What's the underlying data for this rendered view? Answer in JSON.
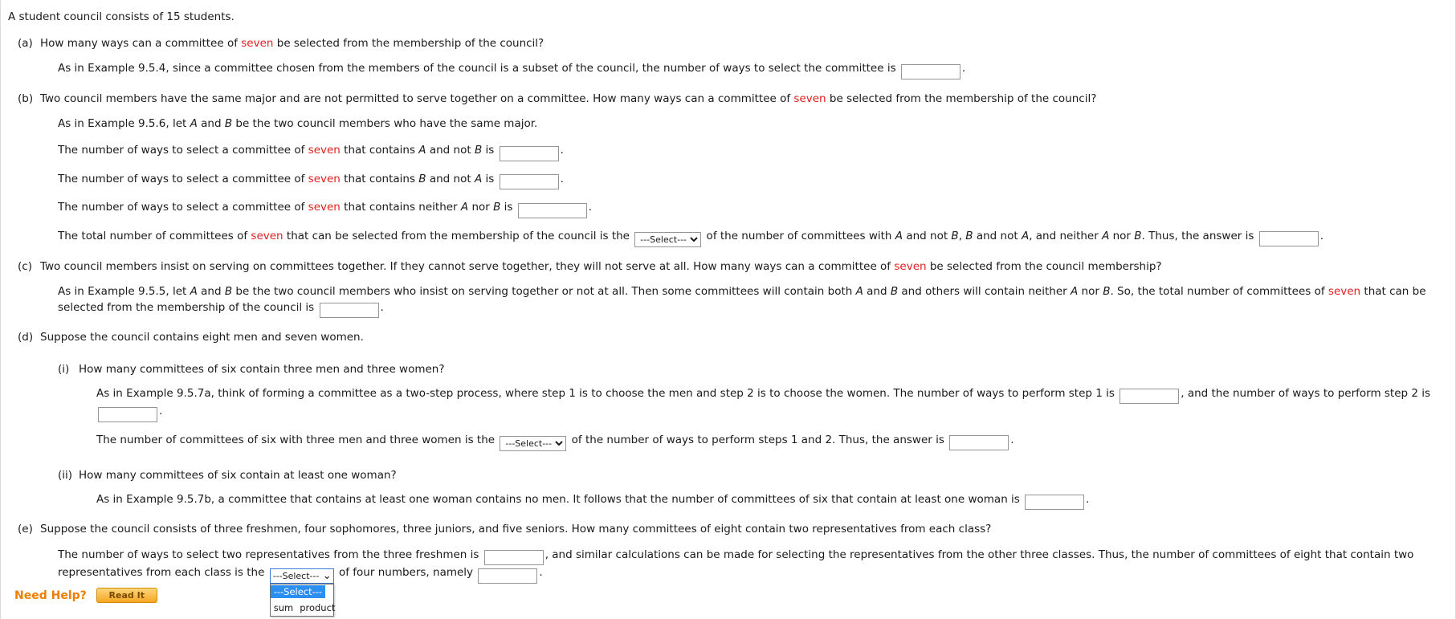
{
  "intro": "A student council consists of 15 students.",
  "parts": {
    "a": {
      "label": "(a)",
      "question_1": "How many ways can a committee of ",
      "question_red": "seven",
      "question_2": " be selected from the membership of the council?",
      "solution_1": "As in Example 9.5.4, since a committee chosen from the members of the council is a subset of the council, the number of ways to select the committee is ",
      "solution_2": ".",
      "blank_value": ""
    },
    "b": {
      "label": "(b)",
      "question_1": "Two council members have the same major and are not permitted to serve together on a committee. How many ways can a committee of ",
      "question_red": "seven",
      "question_2": " be selected from the membership of the council?",
      "line1_a": "As in Example 9.5.6, let ",
      "line1_A": "A",
      "line1_b": " and ",
      "line1_B": "B",
      "line1_c": " be the two council members who have the same major.",
      "line2_a": "The number of ways to select a committee of ",
      "line2_red": "seven",
      "line2_b": " that contains ",
      "line2_A": "A",
      "line2_c": " and not ",
      "line2_B": "B",
      "line2_d": " is ",
      "line2_end": ".",
      "line2_value": "",
      "line3_a": "The number of ways to select a committee of ",
      "line3_red": "seven",
      "line3_b": " that contains ",
      "line3_B": "B",
      "line3_c": " and not ",
      "line3_A": "A",
      "line3_d": " is ",
      "line3_end": ".",
      "line3_value": "",
      "line4_a": "The number of ways to select a committee of ",
      "line4_red": "seven",
      "line4_b": " that contains neither ",
      "line4_A": "A",
      "line4_c": " nor ",
      "line4_B": "B",
      "line4_d": " is ",
      "line4_end": ".",
      "line4_value": "",
      "line5_a": "The total number of committees of ",
      "line5_red": "seven",
      "line5_b": " that can be selected from the membership of the council is the ",
      "line5_c": " of the number of committees with ",
      "line5_A": "A",
      "line5_d": " and not ",
      "line5_B": "B",
      "line5_e": ", ",
      "line5_B2": "B",
      "line5_f": " and not ",
      "line5_A2": "A",
      "line5_g": ", and neither ",
      "line5_A3": "A",
      "line5_h": " nor ",
      "line5_B3": "B",
      "line5_i": ". Thus, the answer is ",
      "line5_end": ".",
      "line5_value": "",
      "select_value": "---Select---"
    },
    "c": {
      "label": "(c)",
      "question_1": "Two council members insist on serving on committees together. If they cannot serve together, they will not serve at all. How many ways can a committee of ",
      "question_red": "seven",
      "question_2": " be selected from the council membership?",
      "sol_a": "As in Example 9.5.5, let ",
      "sol_A": "A",
      "sol_b": " and ",
      "sol_B": "B",
      "sol_c": " be the two council members who insist on serving together or not at all. Then some committees will contain both ",
      "sol_A2": "A",
      "sol_d": " and ",
      "sol_B2": "B",
      "sol_e": " and others will contain neither ",
      "sol_A3": "A",
      "sol_f": " nor ",
      "sol_B3": "B",
      "sol_g": ". So, the total number of committees of ",
      "sol_red": "seven",
      "sol_h": " that can be selected from the membership of the council is ",
      "sol_end": ".",
      "sol_value": ""
    },
    "d": {
      "label": "(d)",
      "question": "Suppose the council contains eight men and seven women.",
      "i": {
        "label": "(i)",
        "question": "How many committees of six contain three men and three women?",
        "line1_a": "As in Example 9.5.7a, think of forming a committee as a two-step process, where step 1 is to choose the men and step 2 is to choose the women. The number of ways to perform step 1 is ",
        "line1_b": ", and the number of ways to perform step 2 is ",
        "line1_end": ".",
        "line1_value1": "",
        "line1_value2": "",
        "line2_a": "The number of committees of six with three men and three women is the ",
        "line2_b": " of the number of ways to perform steps 1 and 2. Thus, the answer is ",
        "line2_end": ".",
        "line2_value": "",
        "select_value": "---Select---"
      },
      "ii": {
        "label": "(ii)",
        "question": "How many committees of six contain at least one woman?",
        "line1_a": "As in Example 9.5.7b, a committee that contains at least one woman contains no men. It follows that the number of committees of six that contain at least one woman is ",
        "line1_end": ".",
        "line1_value": ""
      }
    },
    "e": {
      "label": "(e)",
      "question": "Suppose the council consists of three freshmen, four sophomores, three juniors, and five seniors. How many committees of eight contain two representatives from each class?",
      "line1_a": "The number of ways to select two representatives from the three freshmen is ",
      "line1_b": ", and similar calculations can be made for selecting the representatives from the other three classes. Thus, the number of committees of eight that contain two representatives from each class is the ",
      "line1_c": " of four numbers, namely ",
      "line1_end": ".",
      "line1_value1": "",
      "line1_value2": "",
      "dropdown": {
        "selected": "---Select---",
        "options": [
          "---Select---",
          "sum",
          "product"
        ],
        "open": true
      }
    }
  },
  "select_options": [
    "---Select---",
    "sum",
    "product"
  ],
  "footer": {
    "need_help_label": "Need Help?",
    "read_it_label": "Read It"
  },
  "colors": {
    "highlight_red": "#e02020",
    "need_help_orange": "#ef7d00",
    "dropdown_selected_blue": "#2a8ff0"
  }
}
